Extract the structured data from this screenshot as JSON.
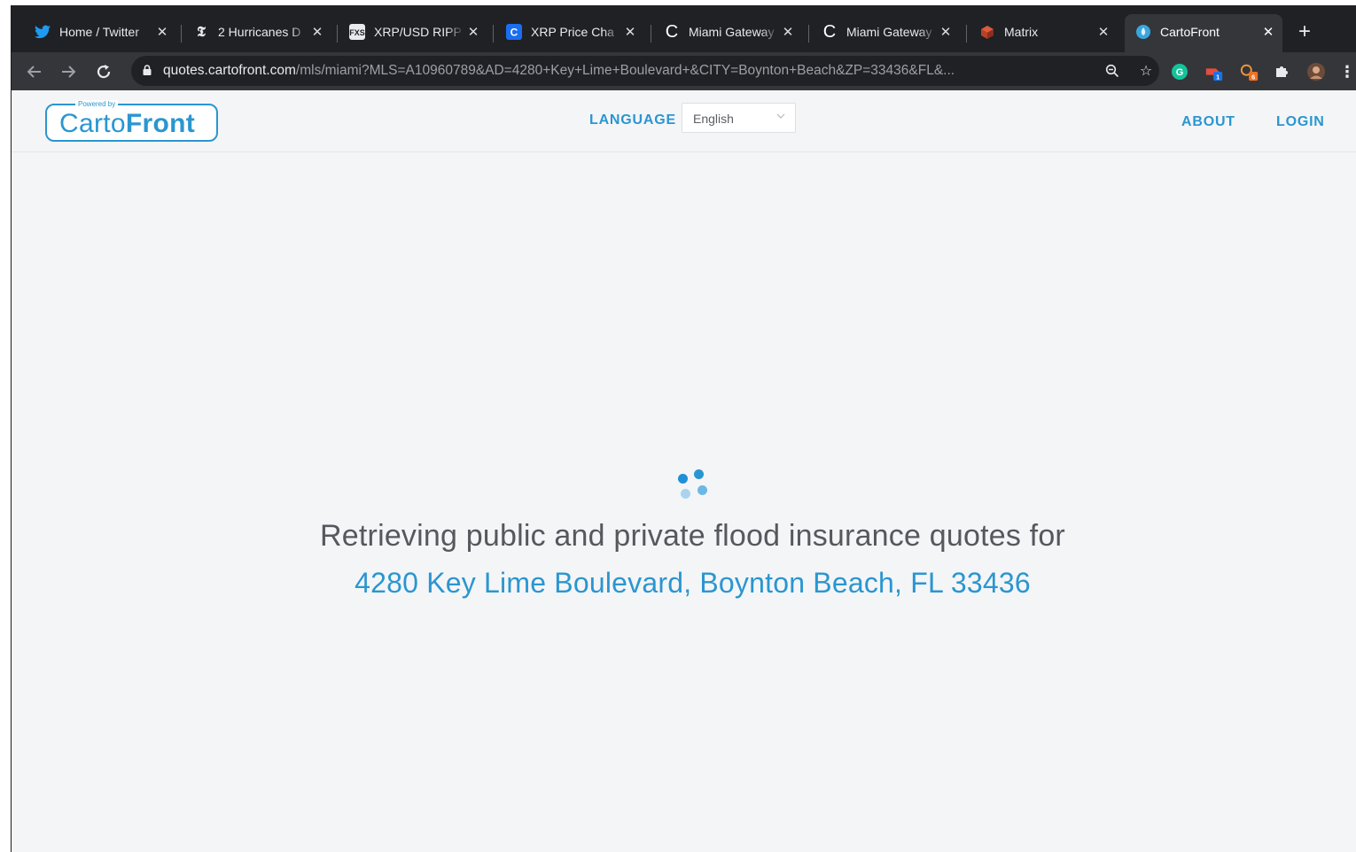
{
  "browser": {
    "tabs": [
      {
        "title": "Home / Twitter",
        "icon": "twitter-icon",
        "active": false
      },
      {
        "title": "2 Hurricanes D",
        "icon": "nytimes-icon",
        "active": false
      },
      {
        "title": "XRP/USD RIPP",
        "icon": "fxs-icon",
        "active": false
      },
      {
        "title": "XRP Price Cha",
        "icon": "coinmarket-icon",
        "active": false
      },
      {
        "title": "Miami Gateway",
        "icon": "c-logo-icon",
        "active": false
      },
      {
        "title": "Miami Gateway",
        "icon": "c-logo-icon",
        "active": false
      },
      {
        "title": "Matrix",
        "icon": "matrix-icon",
        "active": false
      },
      {
        "title": "CartoFront",
        "icon": "cartofront-icon",
        "active": true
      }
    ],
    "new_tab": "+",
    "url_host": "quotes.cartofront.com",
    "url_path": "/mls/miami?MLS=A10960789&AD=4280+Key+Lime+Boulevard+&CITY=Boynton+Beach&ZP=33436&FL&...",
    "extensions": [
      {
        "icon": "grammarly-icon",
        "badge": ""
      },
      {
        "icon": "extension-badge-icon",
        "badge": "1"
      },
      {
        "icon": "extension-badge-icon-2",
        "badge": "6"
      },
      {
        "icon": "puzzle-icon",
        "badge": ""
      },
      {
        "icon": "profile-avatar-icon",
        "badge": ""
      }
    ]
  },
  "header": {
    "logo_powered": "Powered by",
    "logo_light": "Carto",
    "logo_bold": "Front",
    "language_label": "LANGUAGE",
    "language_value": "English",
    "about": "ABOUT",
    "login": "LOGIN"
  },
  "main": {
    "message": "Retrieving public and private flood insurance quotes for",
    "address": "4280 Key Lime Boulevard, Boynton Beach, FL 33436"
  },
  "colors": {
    "accent": "#2a96d0",
    "text": "#55595e",
    "background": "#f4f5f7"
  }
}
